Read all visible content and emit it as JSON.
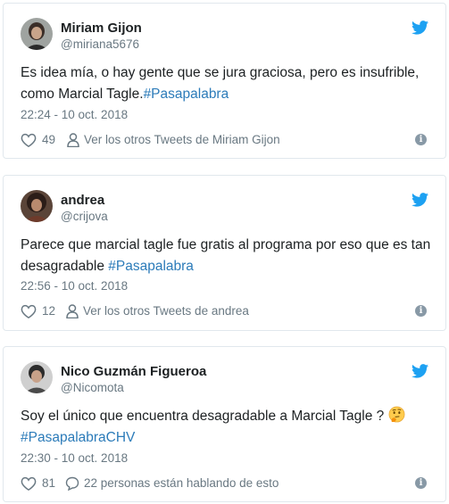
{
  "colors": {
    "link": "#2b7bb9",
    "muted": "#697882",
    "twitter_blue": "#1da1f2",
    "border": "#e1e8ed"
  },
  "tweets": [
    {
      "name": "Miriam Gijon",
      "handle": "@miriana5676",
      "text_before": "Es idea mía, o hay gente que se jura graciosa, pero es insufrible, como Marcial Tagle.",
      "hashtag": "#Pasapalabra",
      "timestamp": "22:24 - 10 oct. 2018",
      "likes": "49",
      "more_link": "Ver los otros Tweets de Miriam Gijon"
    },
    {
      "name": "andrea",
      "handle": "@crijova",
      "text_before": "Parece que marcial tagle fue gratis al programa por eso que es tan desagradable ",
      "hashtag": "#Pasapalabra",
      "timestamp": "22:56 - 10 oct. 2018",
      "likes": "12",
      "more_link": "Ver los otros Tweets de andrea"
    },
    {
      "name": "Nico Guzmán Figueroa",
      "handle": "@Nicomota",
      "text_before": "Soy el único que encuentra desagradable a Marcial Tagle ? ",
      "emoji": "thinking-face-emoji",
      "hashtag": "#PasapalabraCHV",
      "timestamp": "22:30 - 10 oct. 2018",
      "likes": "81",
      "more_link": "22 personas están hablando de esto"
    }
  ]
}
